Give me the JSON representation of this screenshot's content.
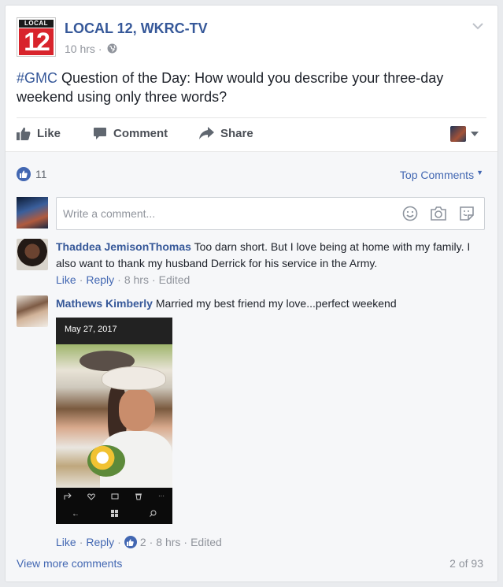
{
  "post": {
    "page_name": "LOCAL 12, WKRC-TV",
    "logo_top": "LOCAL",
    "logo_number": "12",
    "time": "10 hrs",
    "separator": "·",
    "hashtag": "#GMC",
    "text": " Question of the Day: How would you describe your three-day weekend using only three words?"
  },
  "actions": {
    "like": "Like",
    "comment": "Comment",
    "share": "Share"
  },
  "reactions": {
    "count": "11",
    "sort_label": "Top Comments"
  },
  "composer": {
    "placeholder": "Write a comment..."
  },
  "comments": [
    {
      "author": "Thaddea JemisonThomas",
      "text": " Too darn short. But I love being at home with my family. I also want to thank my husband Derrick for his service in the Army.",
      "like": "Like",
      "reply": "Reply",
      "time": "8 hrs",
      "edited": "Edited"
    },
    {
      "author": "Mathews Kimberly",
      "text": " Married my best friend my love...perfect weekend",
      "photo_date": "May 27, 2017",
      "like": "Like",
      "reply": "Reply",
      "reactions": "2",
      "time": "8 hrs",
      "edited": "Edited"
    }
  ],
  "footer": {
    "view_more": "View more comments",
    "count": "2 of 93"
  },
  "colors": {
    "link_blue": "#365899",
    "action_blue": "#4267b2",
    "muted": "#90949c",
    "logo_red": "#d8242c"
  }
}
